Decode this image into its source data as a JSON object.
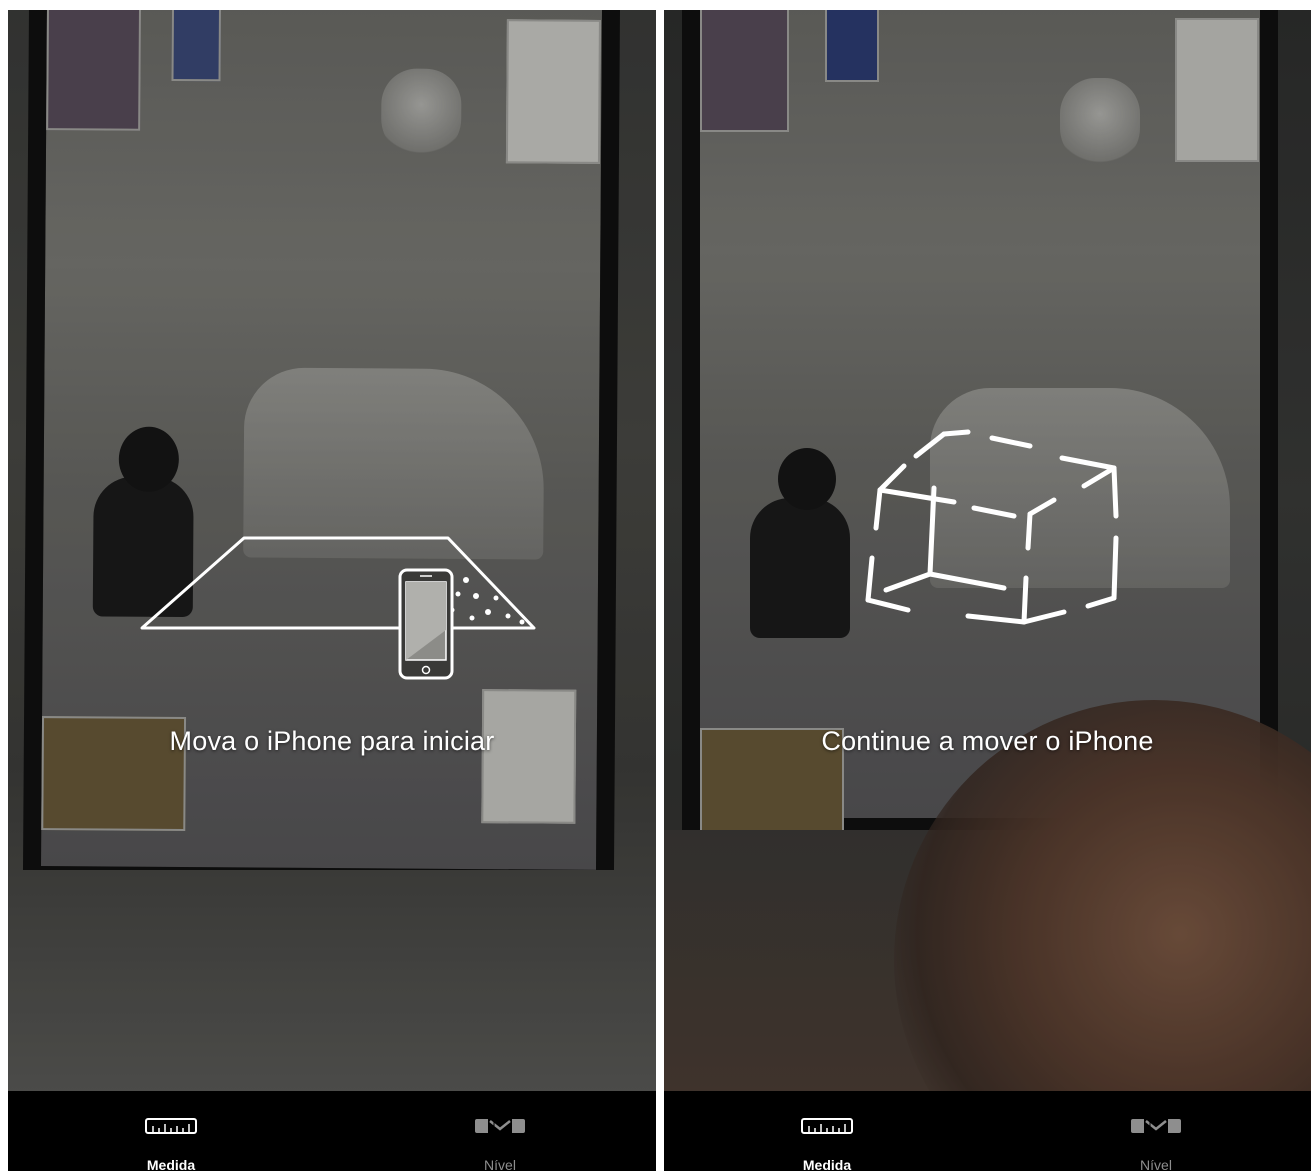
{
  "screens": [
    {
      "instruction": "Mova o iPhone para iniciar",
      "tabs": [
        {
          "label": "Medida",
          "icon": "ruler-icon",
          "active": true
        },
        {
          "label": "Nível",
          "icon": "level-icon",
          "active": false
        }
      ]
    },
    {
      "instruction": "Continue a mover o iPhone",
      "tabs": [
        {
          "label": "Medida",
          "icon": "ruler-icon",
          "active": true
        },
        {
          "label": "Nível",
          "icon": "level-icon",
          "active": false
        }
      ]
    }
  ],
  "colors": {
    "tabbar_background": "#000000",
    "active_tab": "#ffffff",
    "inactive_tab": "#8e8e8e",
    "overlay_text": "#ffffff"
  }
}
